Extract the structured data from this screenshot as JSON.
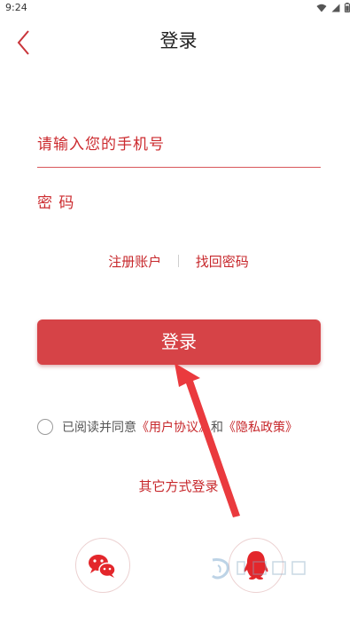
{
  "status_bar": {
    "time": "9:24"
  },
  "nav": {
    "title": "登录"
  },
  "form": {
    "phone_placeholder": "请输入您的手机号",
    "password_placeholder": "密 码",
    "register_link": "注册账户",
    "recover_link": "找回密码",
    "login_button": "登录"
  },
  "agreement": {
    "prefix": "已阅读并同意",
    "user_agreement": "《用户协议》",
    "conjunction": "和",
    "privacy_policy": "《隐私政策》"
  },
  "other_login": {
    "title": "其它方式登录"
  },
  "colors": {
    "accent": "#d64347",
    "text_red": "#c7282c"
  },
  "icons": {
    "back": "chevron-left-icon",
    "wechat": "wechat-icon",
    "qq": "qq-icon",
    "wifi": "wifi-icon",
    "signal": "signal-icon",
    "battery": "battery-icon"
  }
}
